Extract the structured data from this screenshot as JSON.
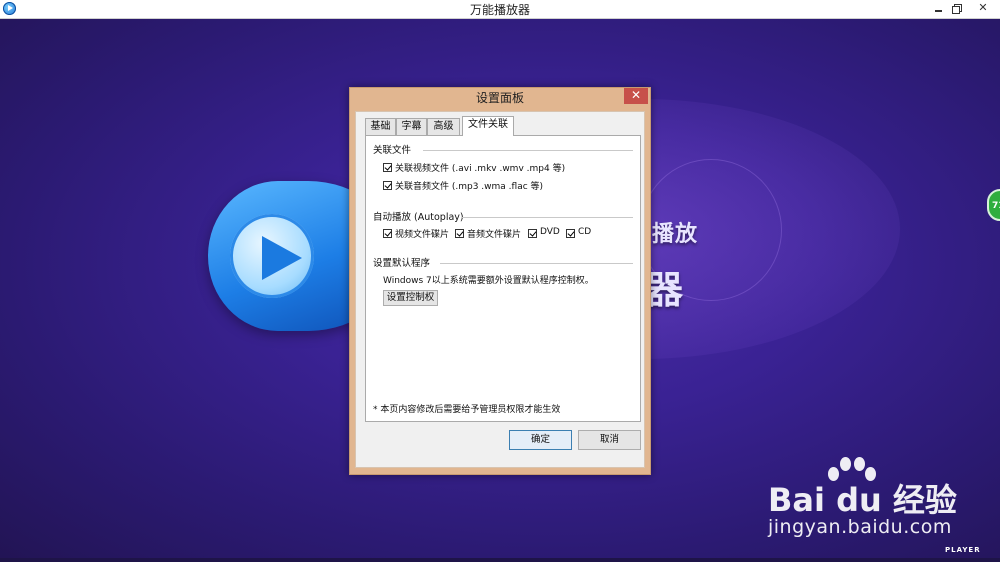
{
  "window": {
    "title": "万能播放器",
    "controls": [
      "minimize",
      "maximize",
      "close"
    ]
  },
  "background": {
    "brand_text_line1": "播放",
    "brand_text_line2": "器",
    "floating_badge": "71",
    "watermark_main": "Bai du 经验",
    "watermark_sub": "jingyan.baidu.com",
    "player_mark": "PLAYER"
  },
  "dialog": {
    "title": "设置面板",
    "close_label": "✕",
    "tabs": [
      {
        "label": "基础",
        "active": false
      },
      {
        "label": "字幕",
        "active": false
      },
      {
        "label": "高级",
        "active": false
      },
      {
        "label": "文件关联",
        "active": true
      }
    ],
    "sections": {
      "assoc": {
        "title": "关联文件",
        "video": {
          "label": "关联视频文件 (.avi .mkv .wmv .mp4 等)",
          "checked": true
        },
        "audio": {
          "label": "关联音频文件 (.mp3 .wma .flac 等)",
          "checked": true
        }
      },
      "autoplay": {
        "title": "自动播放 (Autoplay)",
        "video_disc": {
          "label": "视频文件碟片",
          "checked": true
        },
        "audio_disc": {
          "label": "音频文件碟片",
          "checked": true
        },
        "dvd": {
          "label": "DVD",
          "checked": true
        },
        "cd": {
          "label": "CD",
          "checked": true
        }
      },
      "default_program": {
        "title": "设置默认程序",
        "description": "Windows 7以上系统需要额外设置默认程序控制权。",
        "button": "设置控制权"
      }
    },
    "note": "* 本页内容修改后需要给予管理员权限才能生效",
    "ok_button": "确定",
    "cancel_button": "取消"
  },
  "colors": {
    "dialog_frame": "#e1b690",
    "background": "#3a2294",
    "close_button": "#c7504a",
    "badge": "#2fae3e"
  }
}
